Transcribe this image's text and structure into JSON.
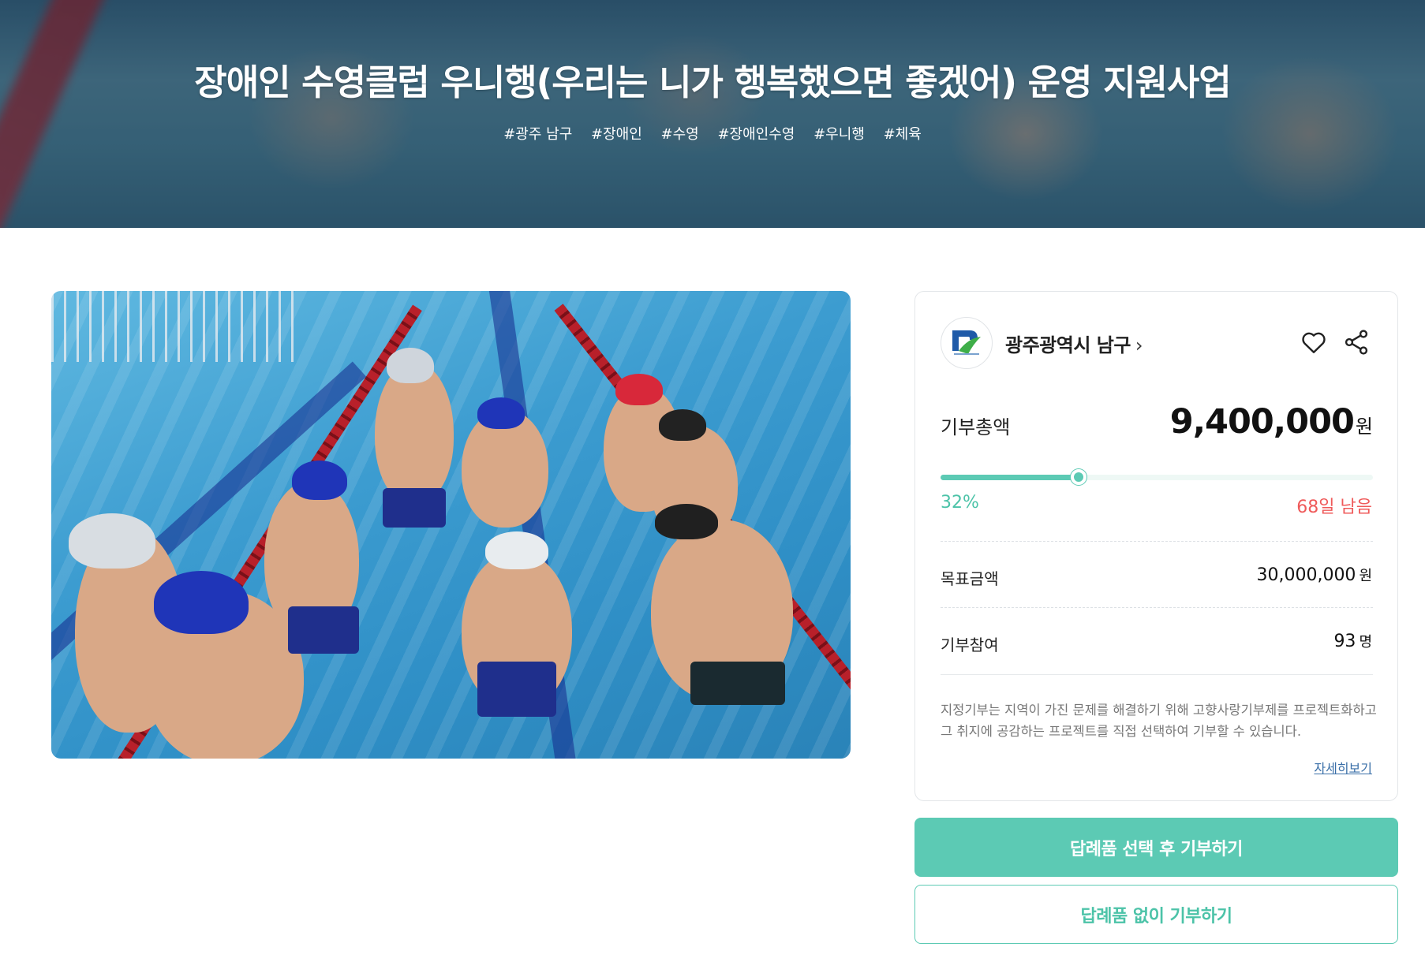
{
  "hero": {
    "title": "장애인 수영클럽 우니행(우리는 니가 행복했으면 좋겠어) 운영 지원사업",
    "tags": [
      "#광주 남구",
      "#장애인",
      "#수영",
      "#장애인수영",
      "#우니행",
      "#체육"
    ]
  },
  "photo": {
    "alt_icon": "pool-photo"
  },
  "organization": {
    "name": "광주광역시 남구",
    "chevron": "›",
    "logo_icon": "gwangju-namgu-logo-icon"
  },
  "actions": {
    "like_icon": "heart-icon",
    "share_icon": "share-icon"
  },
  "donation": {
    "total_label": "기부총액",
    "total_value": "9,400,000",
    "total_unit": "원",
    "progress_percent": 32,
    "progress_label": "32%",
    "days_left": "68일 남음",
    "goal_label": "목표금액",
    "goal_value": "30,000,000",
    "goal_unit": "원",
    "participants_label": "기부참여",
    "participants_value": "93",
    "participants_unit": "명"
  },
  "note": {
    "text": "지정기부는 지역이 가진 문제를 해결하기 위해 고향사랑기부제를 프로젝트화하고 그 취지에 공감하는 프로젝트를 직접 선택하여 기부할 수 있습니다.",
    "more_link": "자세히보기"
  },
  "buttons": {
    "with_gift": "답례품 선택 후 기부하기",
    "without_gift": "답례품 없이 기부하기"
  },
  "colors": {
    "accent": "#5ccab4",
    "accent_text": "#4cc3a8",
    "deadline": "#ef5a5a",
    "link": "#3a6fa8"
  }
}
